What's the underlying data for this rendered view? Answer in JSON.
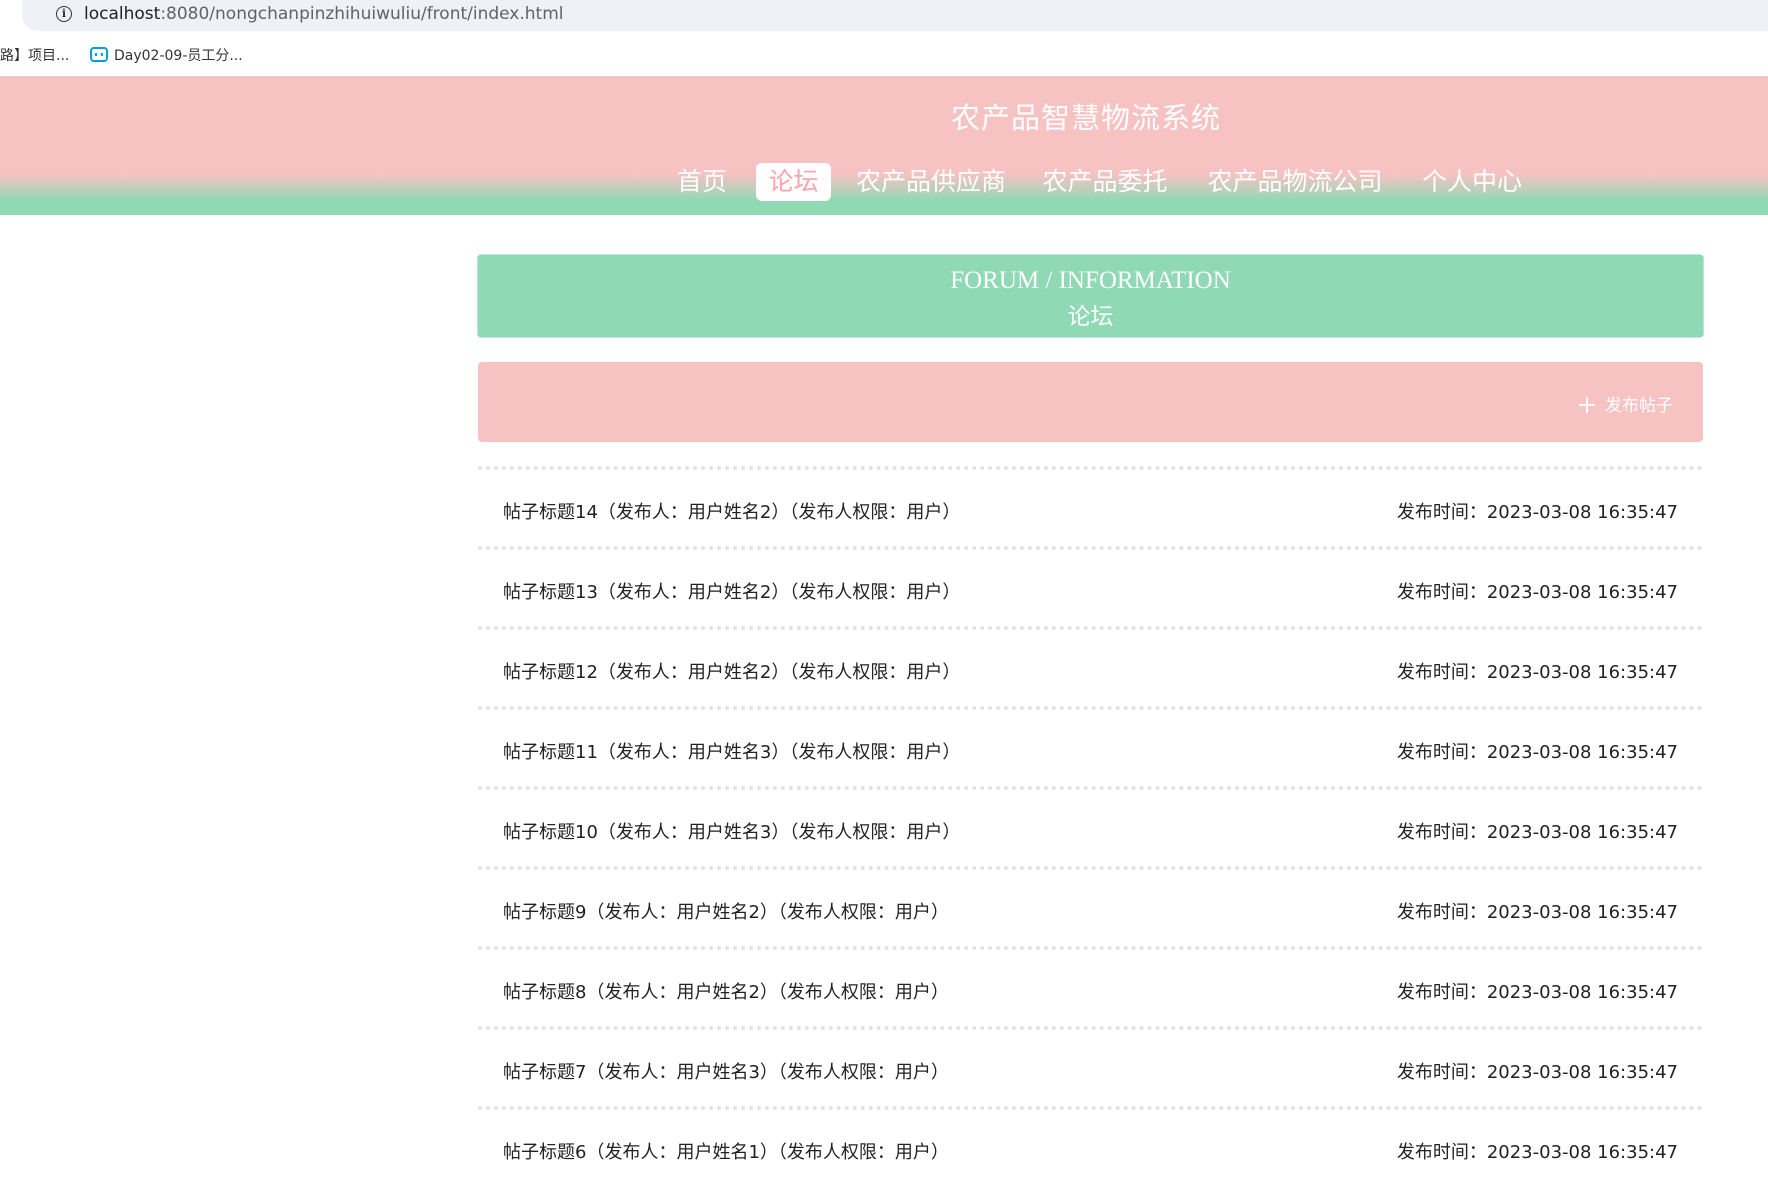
{
  "browser": {
    "url_host": "localhost",
    "url_rest": ":8080/nongchanpinzhihuiwuliu/front/index.html",
    "bookmarks": [
      "路】项目...",
      "Day02-09-员工分..."
    ]
  },
  "header": {
    "site_title": "农产品智慧物流系统",
    "nav": [
      {
        "label": "首页",
        "active": false
      },
      {
        "label": "论坛",
        "active": true
      },
      {
        "label": "农产品供应商",
        "active": false
      },
      {
        "label": "农产品委托",
        "active": false
      },
      {
        "label": "农产品物流公司",
        "active": false
      },
      {
        "label": "个人中心",
        "active": false
      }
    ]
  },
  "banner": {
    "title_en": "FORUM / INFORMATION",
    "title_cn": "论坛"
  },
  "actions": {
    "publish_label": "发布帖子"
  },
  "posts": [
    {
      "title": "帖子标题14（发布人：用户姓名2）（发布人权限：用户）",
      "time": "发布时间：2023-03-08 16:35:47"
    },
    {
      "title": "帖子标题13（发布人：用户姓名2）（发布人权限：用户）",
      "time": "发布时间：2023-03-08 16:35:47"
    },
    {
      "title": "帖子标题12（发布人：用户姓名2）（发布人权限：用户）",
      "time": "发布时间：2023-03-08 16:35:47"
    },
    {
      "title": "帖子标题11（发布人：用户姓名3）（发布人权限：用户）",
      "time": "发布时间：2023-03-08 16:35:47"
    },
    {
      "title": "帖子标题10（发布人：用户姓名3）（发布人权限：用户）",
      "time": "发布时间：2023-03-08 16:35:47"
    },
    {
      "title": "帖子标题9（发布人：用户姓名2）（发布人权限：用户）",
      "time": "发布时间：2023-03-08 16:35:47"
    },
    {
      "title": "帖子标题8（发布人：用户姓名2）（发布人权限：用户）",
      "time": "发布时间：2023-03-08 16:35:47"
    },
    {
      "title": "帖子标题7（发布人：用户姓名3）（发布人权限：用户）",
      "time": "发布时间：2023-03-08 16:35:47"
    },
    {
      "title": "帖子标题6（发布人：用户姓名1）（发布人权限：用户）",
      "time": "发布时间：2023-03-08 16:35:47"
    }
  ]
}
